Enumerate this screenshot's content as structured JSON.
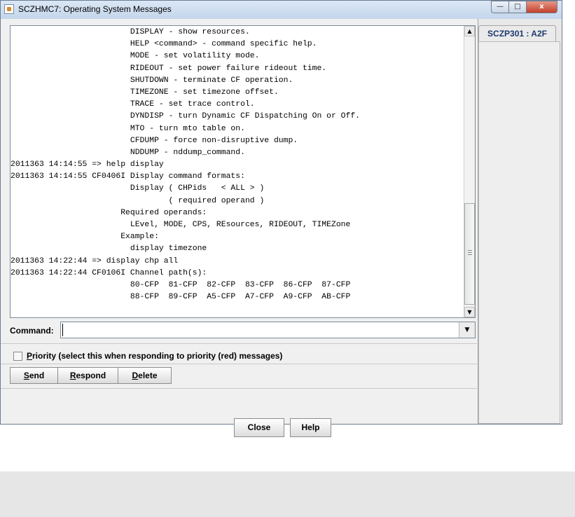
{
  "window": {
    "title": "SCZHMC7: Operating System Messages",
    "controls": {
      "minimize": "—",
      "maximize": "□",
      "close": "x"
    }
  },
  "tab": {
    "label": "SCZP301 : A2F"
  },
  "messages": [
    "                         DISPLAY - show resources.",
    "                         HELP <command> - command specific help.",
    "                         MODE - set volatility mode.",
    "                         RIDEOUT - set power failure rideout time.",
    "                         SHUTDOWN - terminate CF operation.",
    "                         TIMEZONE - set timezone offset.",
    "                         TRACE - set trace control.",
    "                         DYNDISP - turn Dynamic CF Dispatching On or Off.",
    "                         MTO - turn mto table on.",
    "                         CFDUMP - force non-disruptive dump.",
    "                         NDDUMP - nddump_command.",
    "2011363 14:14:55 => help display",
    "2011363 14:14:55 CF0406I Display command formats:",
    "                         Display ( CHPids   < ALL > )",
    "                                 ( required operand )",
    "                       Required operands:",
    "                         LEvel, MODE, CPS, REsources, RIDEOUT, TIMEZone",
    "                       Example:",
    "                         display timezone",
    "2011363 14:22:44 => display chp all",
    "2011363 14:22:44 CF0106I Channel path(s):",
    "                         80-CFP  81-CFP  82-CFP  83-CFP  86-CFP  87-CFP",
    "                         88-CFP  89-CFP  A5-CFP  A7-CFP  A9-CFP  AB-CFP"
  ],
  "command": {
    "label": "Command:",
    "value": ""
  },
  "priority": {
    "first_letter": "P",
    "rest": "riority (select this when responding to priority (red) messages)",
    "checked": false
  },
  "buttons": {
    "send": {
      "u": "S",
      "rest": "end"
    },
    "respond": {
      "u": "R",
      "rest": "espond"
    },
    "delete": {
      "u": "D",
      "rest": "elete"
    },
    "close": "Close",
    "help": "Help"
  },
  "icons": {
    "scroll_up": "triangle-up",
    "scroll_down": "triangle-down",
    "dropdown": "triangle-down"
  }
}
